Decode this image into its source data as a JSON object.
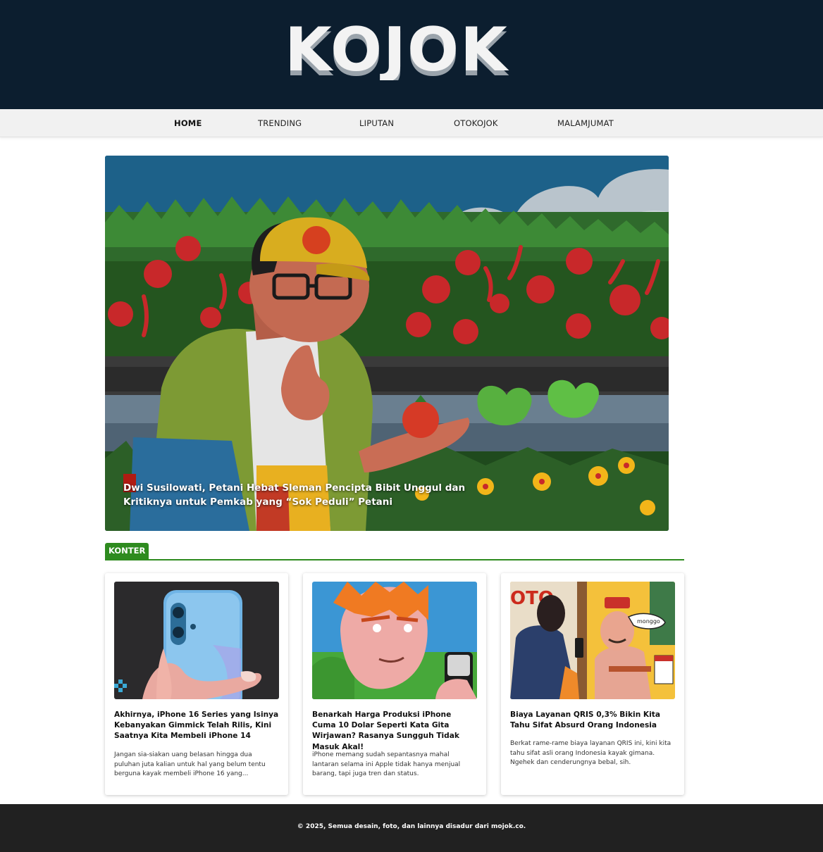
{
  "header": {
    "logo_text": "KOJOK",
    "bg_color": "#0c1e2f"
  },
  "nav": {
    "items": [
      {
        "label": "HOME",
        "active": true
      },
      {
        "label": "TRENDING",
        "active": false
      },
      {
        "label": "LIPUTAN",
        "active": false
      },
      {
        "label": "OTOKOJOK",
        "active": false
      },
      {
        "label": "MALAMJUMAT",
        "active": false
      }
    ]
  },
  "hero": {
    "title": "Dwi Susilowati, Petani Hebat Sleman Pencipta Bibit Unggul dan Kritiknya untuk Pemkab yang “Sok Peduli” Petani",
    "image": "farmer-with-tomato-illustration"
  },
  "section": {
    "label": "KONTER",
    "accent_color": "#2e8b1f"
  },
  "cards": [
    {
      "image": "hand-holding-blue-iphone",
      "title": "Akhirnya, iPhone 16 Series yang Isinya Kebanyakan Gimmick Telah Rilis, Kini Saatnya Kita Membeli iPhone 14",
      "excerpt": "Jangan sia-siakan uang belasan hingga dua puluhan juta kalian untuk hal yang belum tentu berguna kayak membeli iPhone 16 yang..."
    },
    {
      "image": "cartoon-man-with-phone",
      "title": "Benarkah Harga Produksi iPhone Cuma 10 Dolar Seperti Kata Gita Wirjawan? Rasanya Sungguh Tidak Masuk Akal!",
      "excerpt": "iPhone memang sudah sepantasnya mahal lantaran selama ini Apple tidak hanya menjual barang, tapi juga tren dan status."
    },
    {
      "image": "qris-shop-illustration",
      "title": "Biaya Layanan QRIS 0,3% Bikin Kita Tahu Sifat Absurd Orang Indonesia",
      "excerpt": "Berkat rame-rame biaya layanan QRIS ini, kini kita tahu sifat asli orang Indonesia kayak gimana. Ngehek dan cenderungnya bebal, sih."
    }
  ],
  "footer": {
    "text": "© 2025, Semua desain, foto, dan lainnya disadur dari mojok.co."
  }
}
